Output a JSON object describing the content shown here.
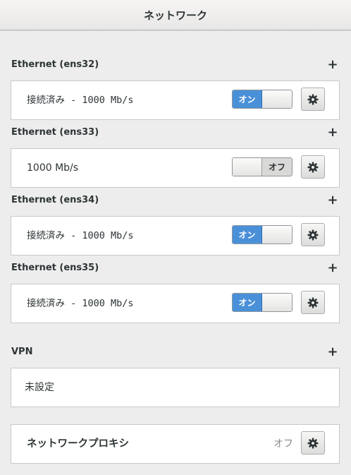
{
  "window": {
    "title": "ネットワーク"
  },
  "sections": [
    {
      "title": "Ethernet (ens32)",
      "status": "接続済み - 1000 Mb/s",
      "toggle": "オン",
      "on": true
    },
    {
      "title": "Ethernet (ens33)",
      "status": "1000 Mb/s",
      "toggle": "オフ",
      "on": false
    },
    {
      "title": "Ethernet (ens34)",
      "status": "接続済み - 1000 Mb/s",
      "toggle": "オン",
      "on": true
    },
    {
      "title": "Ethernet (ens35)",
      "status": "接続済み - 1000 Mb/s",
      "toggle": "オン",
      "on": true
    }
  ],
  "vpn": {
    "title": "VPN",
    "status": "未設定"
  },
  "proxy": {
    "label": "ネットワークプロキシ",
    "state": "オフ"
  },
  "icons": {
    "add": "plus-icon",
    "settings": "gear-icon"
  },
  "colors": {
    "accent": "#4a90d9",
    "background": "#ededed"
  }
}
